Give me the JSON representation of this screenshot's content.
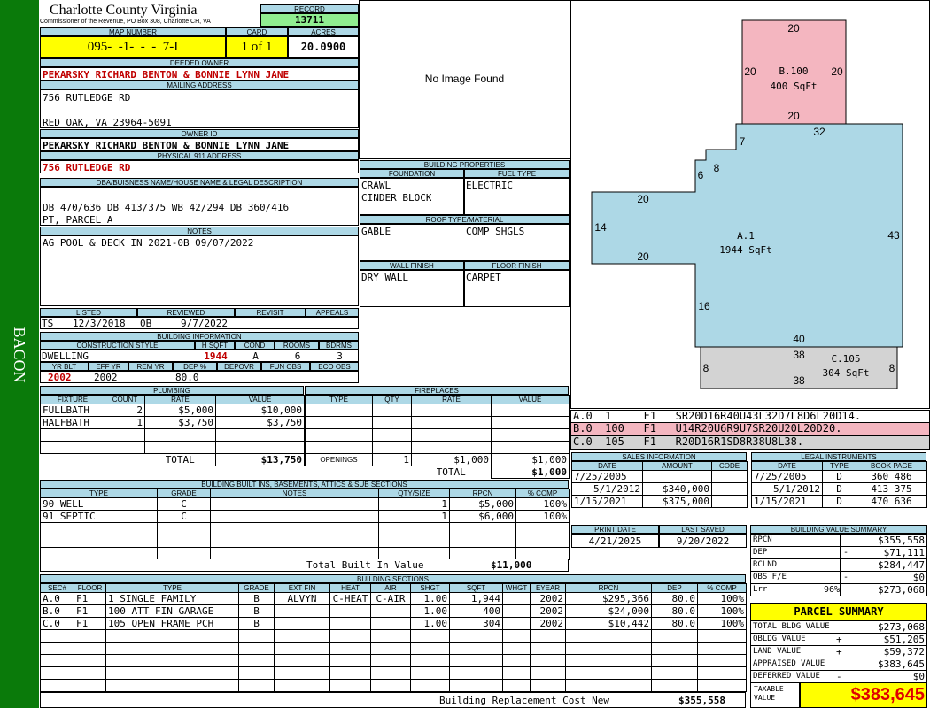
{
  "side_label": "BACON",
  "header": {
    "county": "Charlotte County Virginia",
    "commissioner": "Commissioner of the Revenue, PO Box 308, Charlotte CH, VA",
    "record_label": "RECORD",
    "record": "13711"
  },
  "parcel": {
    "map_label": "MAP NUMBER",
    "map_number": "095-  -1-  -  -  7-I",
    "card_label": "CARD",
    "card": "1 of 1",
    "acres_label": "ACRES",
    "acres": "20.0900"
  },
  "owner": {
    "deeded_label": "DEEDED OWNER",
    "deeded": "PEKARSKY RICHARD BENTON & BONNIE LYNN JANE",
    "mailing_label": "MAILING ADDRESS",
    "mail1": "756 RUTLEDGE RD",
    "mail2": "RED OAK, VA 23964-5091",
    "owner_id_label": "OWNER ID",
    "owner_id": "PEKARSKY RICHARD BENTON & BONNIE LYNN JANE",
    "physical_label": "PHYSICAL 911 ADDRESS",
    "physical": "756 RUTLEDGE RD"
  },
  "legal": {
    "label": "DBA/BUISNESS NAME/HOUSE NAME & LEGAL DESCRIPTION",
    "line1": "DB 470/636 DB 413/375 WB 42/294 DB 360/416",
    "line2": "PT, PARCEL A"
  },
  "notes": {
    "label": "NOTES",
    "text": "AG POOL & DECK IN 2021-0B 09/07/2022"
  },
  "image": {
    "text": "No Image Found"
  },
  "building_props": {
    "label": "BUILDING PROPERTIES",
    "foundation_label": "FOUNDATION",
    "fuel_label": "FUEL TYPE",
    "foundation1": "CRAWL",
    "foundation2": "CINDER BLOCK",
    "fuel": "ELECTRIC",
    "roof_label": "ROOF TYPE/MATERIAL",
    "roof_type": "GABLE",
    "roof_material": "COMP SHGLS",
    "wall_label": "WALL FINISH",
    "floor_label": "FLOOR FINISH",
    "wall": "DRY WALL",
    "floor": "CARPET"
  },
  "listing": {
    "listed_label": "LISTED",
    "reviewed_label": "REVIEWED",
    "revisit_label": "REVISIT",
    "appeals_label": "APPEALS",
    "listed_by": "TS",
    "listed_date": "12/3/2018",
    "reviewed_by": "0B",
    "reviewed_date": "9/7/2022"
  },
  "building_info": {
    "label": "BUILDING INFORMATION",
    "style_label": "CONSTRUCTION STYLE",
    "hsqft_label": "H SQFT",
    "cond_label": "COND",
    "rooms_label": "ROOMS",
    "bdrms_label": "BDRMS",
    "style": "DWELLING",
    "hsqft": "1944",
    "cond": "A",
    "rooms": "6",
    "bdrms": "3",
    "yrblt_label": "YR BLT",
    "effyr_label": "EFF YR",
    "remyr_label": "REM YR",
    "dep_label": "DEP %",
    "depovr_label": "DEPOVR",
    "funobs_label": "FUN OBS",
    "ecoobs_label": "ECO OBS",
    "yrblt": "2002",
    "effyr": "2002",
    "dep": "80.0"
  },
  "plumbing": {
    "label": "PLUMBING",
    "headers": [
      "FIXTURE",
      "COUNT",
      "RATE",
      "VALUE"
    ],
    "rows": [
      [
        "FULLBATH",
        "2",
        "$5,000",
        "$10,000"
      ],
      [
        "HALFBATH",
        "1",
        "$3,750",
        "$3,750"
      ],
      [
        "",
        "",
        "",
        ""
      ],
      [
        "",
        "",
        "",
        ""
      ]
    ],
    "total_label": "TOTAL",
    "total": "$13,750"
  },
  "fireplaces": {
    "label": "FIREPLACES",
    "headers": [
      "TYPE",
      "QTY",
      "RATE",
      "VALUE"
    ],
    "openings_label": "OPENINGS",
    "openings_qty": "1",
    "openings_rate": "$1,000",
    "openings_value": "$1,000",
    "total_label": "TOTAL",
    "total": "$1,000"
  },
  "builtins": {
    "label": "BUILDING BUILT INS, BASEMENTS, ATTICS & SUB SECTIONS",
    "headers": [
      "TYPE",
      "GRADE",
      "NOTES",
      "QTY/SIZE",
      "RPCN",
      "% COMP"
    ],
    "rows": [
      [
        "90 WELL",
        "C",
        "",
        "1",
        "$5,000",
        "100%"
      ],
      [
        "91 SEPTIC",
        "C",
        "",
        "1",
        "$6,000",
        "100%"
      ]
    ],
    "total_label": "Total Built In Value",
    "total": "$11,000"
  },
  "sections": {
    "label": "BUILDING SECTIONS",
    "headers": [
      "SEC#",
      "FLOOR",
      "TYPE",
      "GRADE",
      "EXT FIN",
      "HEAT",
      "AIR",
      "SHGT",
      "SQFT",
      "WHGT",
      "EYEAR",
      "RPCN",
      "DEP",
      "% COMP"
    ],
    "rows": [
      [
        "A.0",
        "F1",
        "1 SINGLE FAMILY",
        "B",
        "ALVYN",
        "C-HEAT",
        "C-AIR",
        "1.00",
        "1,944",
        "",
        "2002",
        "$295,366",
        "80.0",
        "100%"
      ],
      [
        "B.0",
        "F1",
        "100 ATT FIN GARAGE",
        "B",
        "",
        "",
        "",
        "1.00",
        "400",
        "",
        "2002",
        "$24,000",
        "80.0",
        "100%"
      ],
      [
        "C.0",
        "F1",
        "105 OPEN FRAME PCH",
        "B",
        "",
        "",
        "",
        "1.00",
        "304",
        "",
        "2002",
        "$10,442",
        "80.0",
        "100%"
      ]
    ],
    "rcn_label": "Building Replacement Cost New",
    "rcn": "$355,558"
  },
  "sketch": {
    "b100_name": "B.100",
    "b100_area": "400 SqFt",
    "a1_name": "A.1",
    "a1_area": "1944 SqFt",
    "c105_name": "C.105",
    "c105_area": "304 SqFt",
    "dims": {
      "b_top": "20",
      "b_left": "20",
      "b_right": "20",
      "b_bottom": "20",
      "a_32": "32",
      "a_7": "7",
      "a_8": "8",
      "a_6": "6",
      "a_20a": "20",
      "a_14": "14",
      "a_20b": "20",
      "a_43": "43",
      "a_16": "16",
      "a_40": "40",
      "c_38a": "38",
      "c_8a": "8",
      "c_8b": "8",
      "c_38b": "38"
    },
    "colors": {
      "b": "#f4b6c0",
      "a": "#add8e6",
      "c": "#d3d3d3"
    }
  },
  "vectors": [
    {
      "sec": "A.0",
      "num": "1",
      "floor": "F1",
      "path": "SR20D16R40U43L32D7L8D6L20D14.",
      "bg": "#ffffff"
    },
    {
      "sec": "B.0",
      "num": "100",
      "floor": "F1",
      "path": "U14R20U6R9U7SR20U20L20D20.",
      "bg": "#f4b6c0"
    },
    {
      "sec": "C.0",
      "num": "105",
      "floor": "F1",
      "path": "R20D16R1SD8R38U8L38.",
      "bg": "#d3d3d3"
    }
  ],
  "sales": {
    "label": "SALES INFORMATION",
    "headers": [
      "DATE",
      "AMOUNT",
      "CODE"
    ],
    "rows": [
      [
        "7/25/2005",
        "",
        ""
      ],
      [
        "5/1/2012",
        "$340,000",
        ""
      ],
      [
        "1/15/2021",
        "$375,000",
        ""
      ]
    ]
  },
  "legal_instruments": {
    "label": "LEGAL INSTRUMENTS",
    "headers": [
      "DATE",
      "TYPE",
      "BOOK PAGE"
    ],
    "rows": [
      [
        "7/25/2005",
        "D",
        "360 486"
      ],
      [
        "5/1/2012",
        "D",
        "413 375"
      ],
      [
        "1/15/2021",
        "D",
        "470 636"
      ]
    ]
  },
  "dates": {
    "print_label": "PRINT DATE",
    "saved_label": "LAST SAVED",
    "print": "4/21/2025",
    "saved": "9/20/2022"
  },
  "value_summary": {
    "label": "BUILDING VALUE SUMMARY",
    "rows": [
      [
        "RPCN",
        "",
        "$355,558"
      ],
      [
        "DEP",
        "-",
        "$71,111"
      ],
      [
        "RCLND",
        "",
        "$284,447"
      ],
      [
        "OBS F/E",
        "-",
        "$0"
      ],
      [
        "Lrr",
        "96%",
        "$273,068"
      ]
    ]
  },
  "parcel_summary": {
    "label": "PARCEL SUMMARY",
    "rows": [
      [
        "TOTAL BLDG VALUE",
        "",
        "$273,068"
      ],
      [
        "OBLDG VALUE",
        "+",
        "$51,205"
      ],
      [
        "LAND VALUE",
        "+",
        "$59,372"
      ],
      [
        "APPRAISED VALUE",
        "",
        "$383,645"
      ],
      [
        "DEFERRED VALUE",
        "-",
        "$0"
      ]
    ],
    "taxable_label": "TAXABLE VALUE",
    "taxable": "$383,645"
  },
  "colors": {
    "green": "#0a7a0a",
    "yellow": "#ffff00",
    "lightgreen": "#90ee90",
    "lightblue": "#add8e6",
    "header_yellow": "#ffff00",
    "red": "#c00000"
  }
}
